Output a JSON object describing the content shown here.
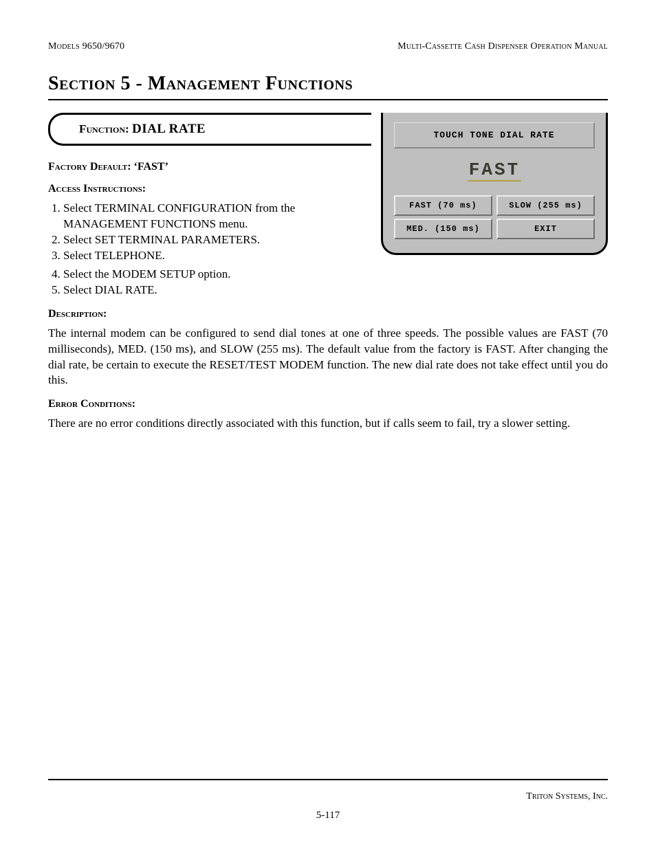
{
  "header": {
    "left": "Models 9650/9670",
    "right": "Multi-Cassette Cash Dispenser Operation Manual"
  },
  "section_title": "Section 5 - Management Functions",
  "function_box": {
    "label": "Function:  ",
    "name": "DIAL RATE"
  },
  "factory_default": {
    "label": "Factory Default: ",
    "value": "‘FAST’"
  },
  "access": {
    "heading": "Access Instructions:",
    "steps": [
      "Select TERMINAL CONFIGURATION from the MANAGEMENT FUNCTIONS menu.",
      "Select SET TERMINAL PARAMETERS.",
      "Select TELEPHONE.",
      "Select the MODEM SETUP option.",
      "Select DIAL RATE."
    ]
  },
  "description": {
    "heading": "Description:",
    "text": "The internal modem can be configured to send dial tones at one of three speeds.  The possible values are FAST (70 milliseconds), MED. (150 ms), and SLOW (255 ms).  The default value from the factory is FAST.  After changing the dial rate, be certain to execute the RESET/TEST MODEM function.  The new dial rate does not take effect until you do this."
  },
  "error": {
    "heading": "Error Conditions:",
    "text": "There are no error conditions directly associated with this function, but if calls seem to fail, try a slower setting."
  },
  "terminal": {
    "title": "TOUCH TONE DIAL RATE",
    "current": "FAST",
    "buttons": {
      "fast": "FAST (70 ms)",
      "slow": "SLOW (255 ms)",
      "med": "MED. (150 ms)",
      "exit": "EXIT"
    }
  },
  "footer": {
    "company": "Triton Systems, Inc.",
    "page": "5-117"
  }
}
